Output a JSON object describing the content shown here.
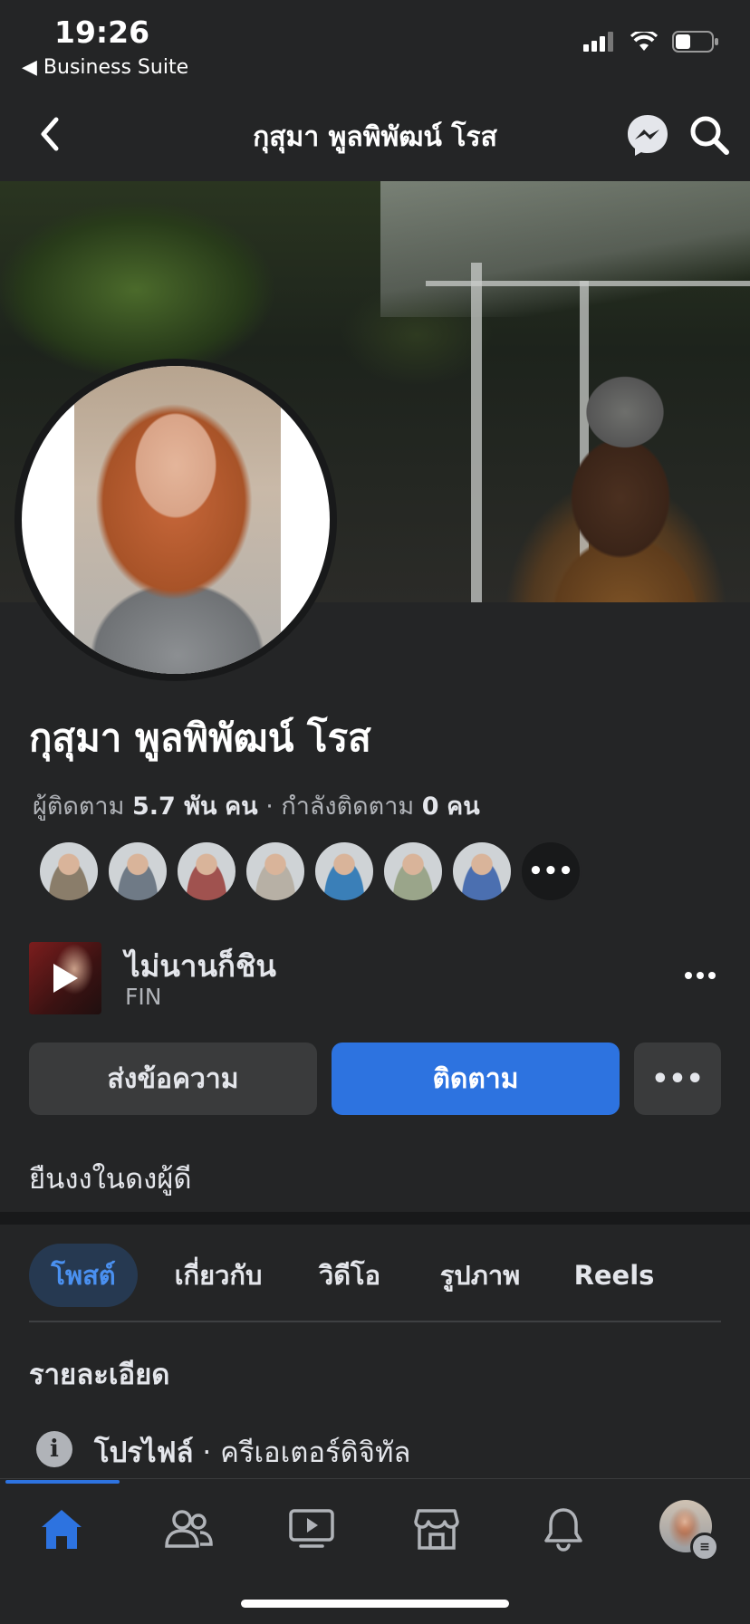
{
  "status_bar": {
    "time": "19:26",
    "back_app": "◀ Business Suite"
  },
  "header": {
    "title": "กุสุมา พูลพิพัฒน์ โรส"
  },
  "profile": {
    "name": "กุสุมา พูลพิพัฒน์ โรส",
    "followers_label": "ผู้ติดตาม",
    "followers_count": "5.7 พัน",
    "followers_unit": "คน",
    "following_label": "กำลังติดตาม",
    "following_count": "0",
    "following_unit": "คน",
    "follower_avatar_colors": [
      "#8a7d6a",
      "#6f7a86",
      "#a0524f",
      "#b7b0a5",
      "#3a7fb8",
      "#9aa58a",
      "#4b6fb0"
    ],
    "more_followers": "•••"
  },
  "music": {
    "title": "ไม่นานก็ชิน",
    "artist": "FIN"
  },
  "buttons": {
    "message": "ส่งข้อความ",
    "follow": "ติดตาม",
    "more": "•••"
  },
  "bio": "ยืนงงในดงผู้ดี",
  "tabs": [
    "โพสต์",
    "เกี่ยวกับ",
    "วิดีโอ",
    "รูปภาพ",
    "Reels"
  ],
  "details": {
    "title": "รายละเอียด",
    "type_label": "โปรไฟล์",
    "type_value": " · ครีเอเตอร์ดิจิทัล"
  },
  "colors": {
    "background": "#242526",
    "accent": "#2d73e0",
    "tab_active_bg": "#263951",
    "secondary_text": "#b0b3b8"
  },
  "icons": {
    "header": [
      "back-chevron-icon",
      "messenger-icon",
      "search-icon"
    ],
    "bottom_nav": [
      "home-icon",
      "friends-icon",
      "video-icon",
      "marketplace-icon",
      "bell-icon",
      "profile-avatar"
    ]
  }
}
